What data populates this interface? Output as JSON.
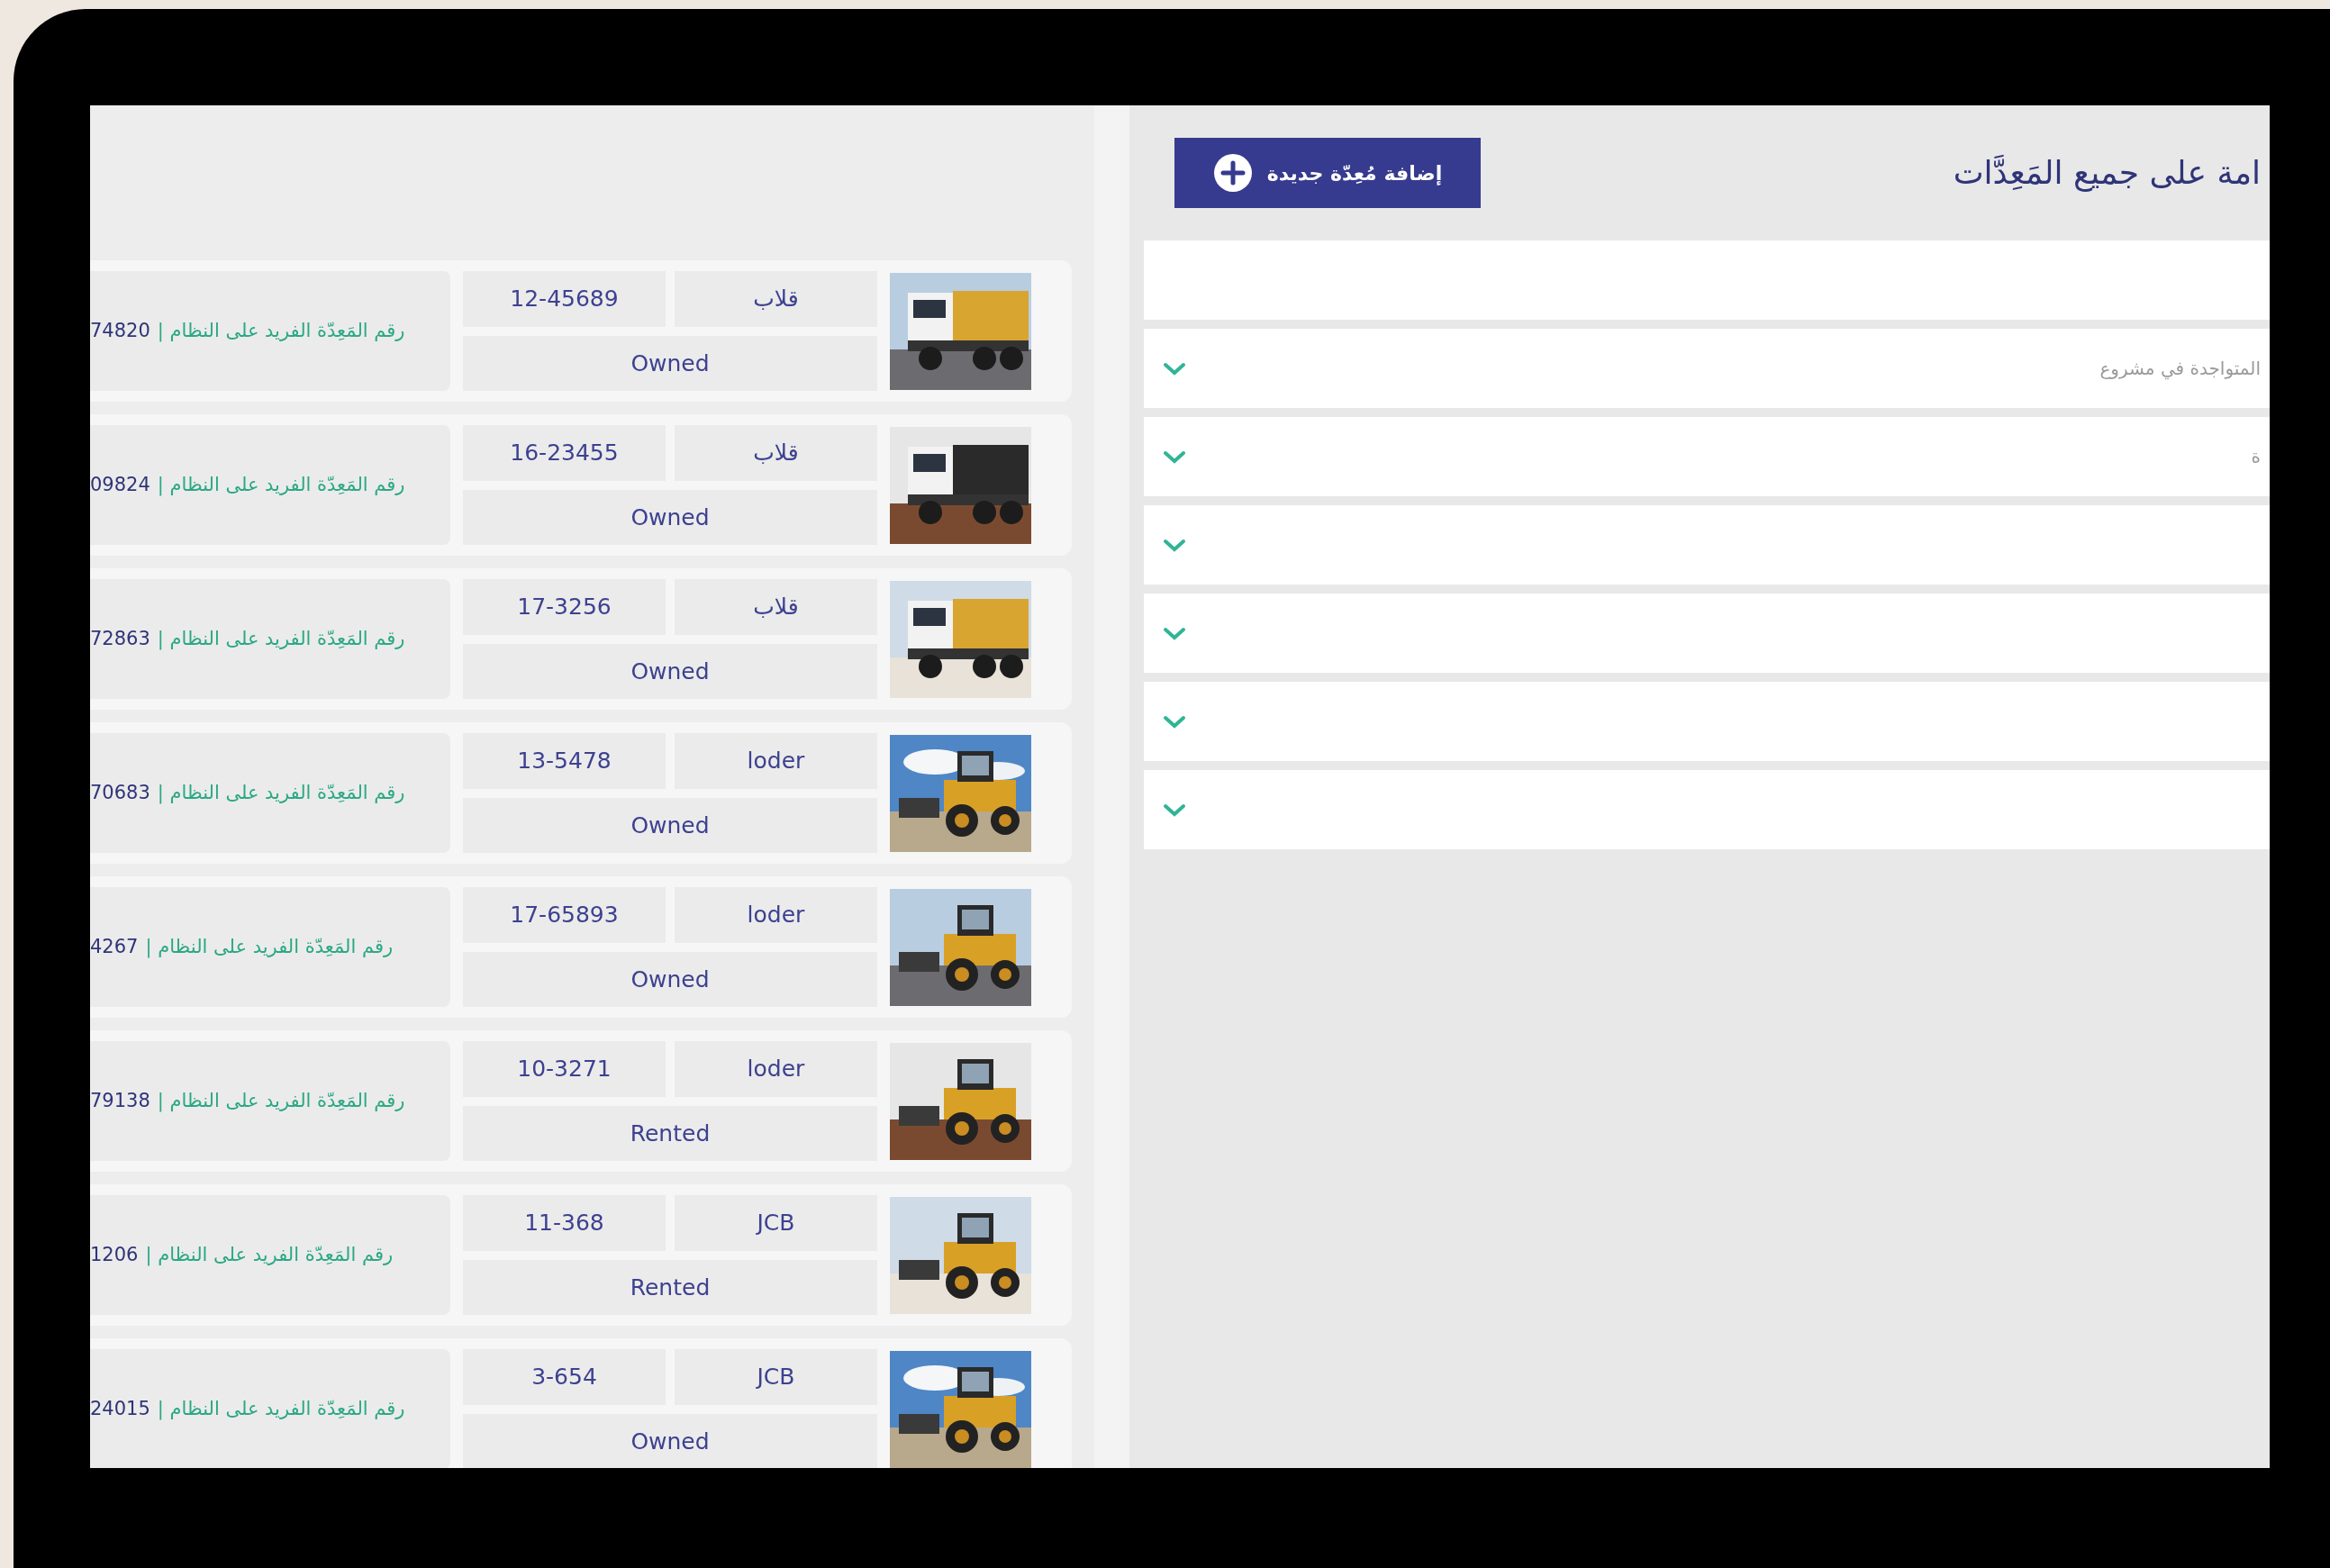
{
  "header": {
    "title": "امة على جميع المَعِدَّات",
    "add_button": "إضافة مُعِدّة جديدة"
  },
  "filters": [
    {
      "kind": "blank"
    },
    {
      "kind": "dropdown",
      "label": "المتواجدة في مشروع",
      "expanded": false
    },
    {
      "kind": "dropdown",
      "label": "ة",
      "expanded": false
    },
    {
      "kind": "dropdown",
      "expanded": false
    },
    {
      "kind": "dropdown",
      "expanded": false
    },
    {
      "kind": "dropdown",
      "expanded": false
    },
    {
      "kind": "dropdown",
      "expanded": false
    }
  ],
  "equipment": [
    {
      "kind": "picture",
      "plate": "12-45689",
      "type": "قلاب",
      "ownership": "Owned",
      "id_label": "رقم المَعِدّة الفريد على النظام |",
      "id": "74820"
    },
    {
      "kind": "picture",
      "plate": "16-23455",
      "type": "قلاب",
      "ownership": "Owned",
      "id_label": "رقم المَعِدّة الفريد على النظام |",
      "id": "09824"
    },
    {
      "kind": "picture",
      "plate": "17-3256",
      "type": "قلاب",
      "ownership": "Owned",
      "id_label": "رقم المَعِدّة الفريد على النظام |",
      "id": "72863"
    },
    {
      "kind": "picture",
      "plate": "13-5478",
      "type": "loder",
      "ownership": "Owned",
      "id_label": "رقم المَعِدّة الفريد على النظام |",
      "id": "70683"
    },
    {
      "kind": "picture",
      "plate": "17-65893",
      "type": "loder",
      "ownership": "Owned",
      "id_label": "رقم المَعِدّة الفريد على النظام |",
      "id": "4267"
    },
    {
      "kind": "picture",
      "plate": "10-3271",
      "type": "loder",
      "ownership": "Rented",
      "id_label": "رقم المَعِدّة الفريد على النظام |",
      "id": "79138"
    },
    {
      "kind": "picture",
      "plate": "11-368",
      "type": "JCB",
      "ownership": "Rented",
      "id_label": "رقم المَعِدّة الفريد على النظام |",
      "id": "1206"
    },
    {
      "kind": "picture",
      "plate": "3-654",
      "type": "JCB",
      "ownership": "Owned",
      "id_label": "رقم المَعِدّة الفريد على النظام |",
      "id": "24015"
    }
  ]
}
